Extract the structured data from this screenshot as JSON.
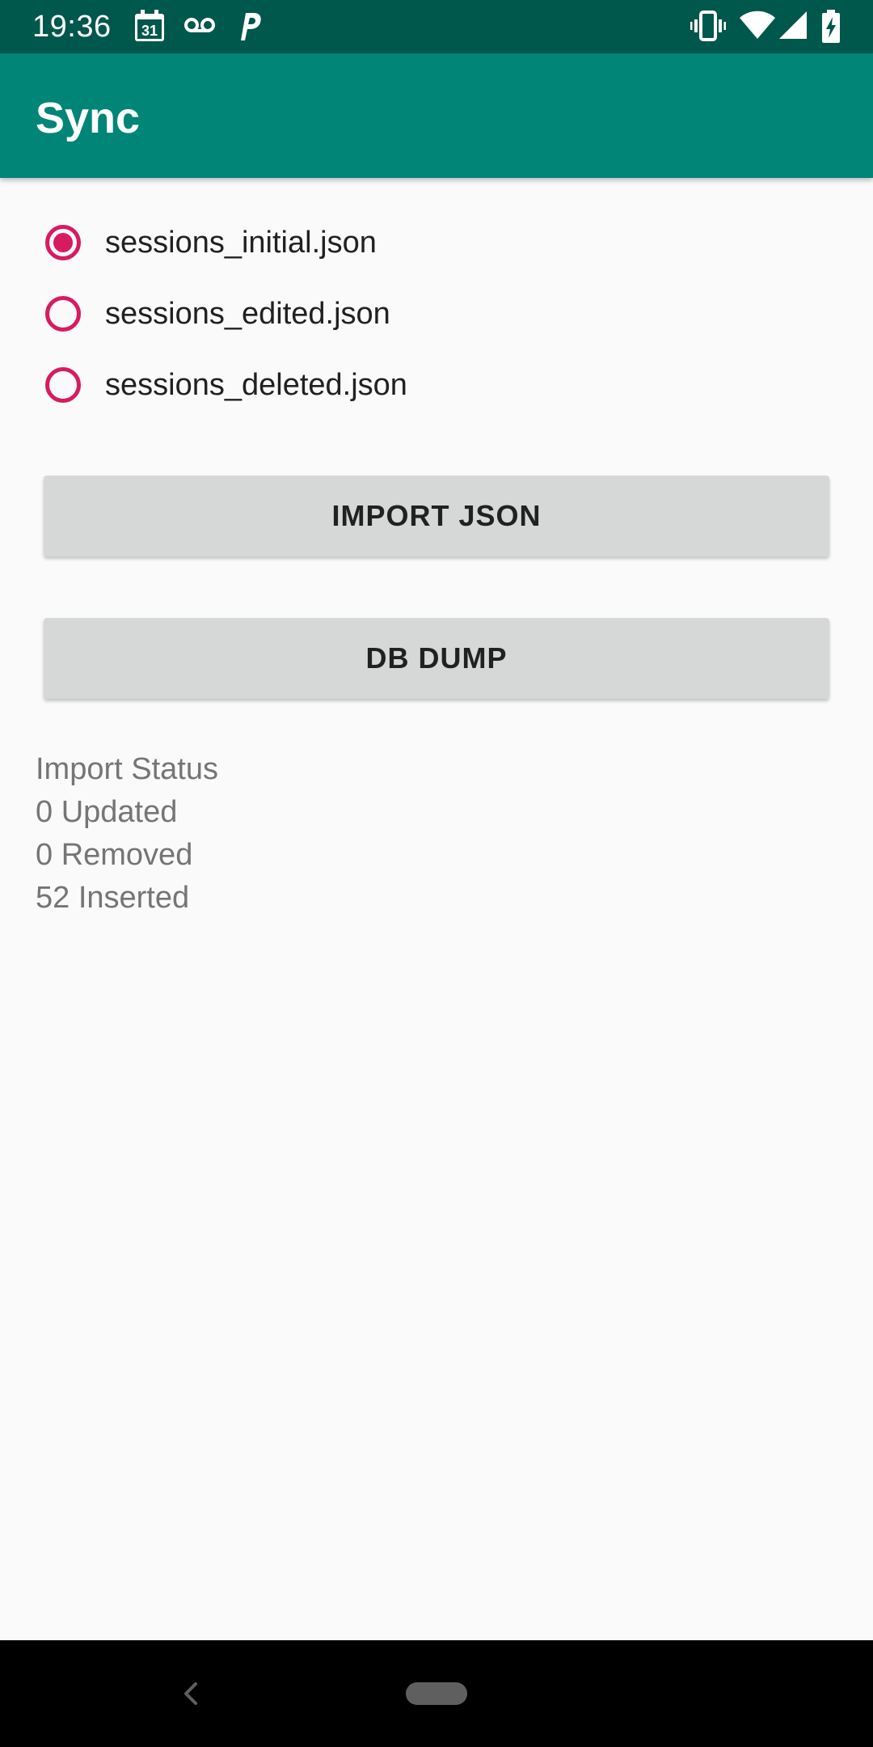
{
  "status_bar": {
    "time": "19:36",
    "calendar_day": "31",
    "icons": [
      "calendar-icon",
      "voicemail-icon",
      "parking-icon",
      "vibrate-icon",
      "wifi-icon",
      "signal-icon",
      "battery-charging-icon"
    ]
  },
  "app_bar": {
    "title": "Sync"
  },
  "radio_group": {
    "options": [
      {
        "label": "sessions_initial.json",
        "checked": true
      },
      {
        "label": "sessions_edited.json",
        "checked": false
      },
      {
        "label": "sessions_deleted.json",
        "checked": false
      }
    ]
  },
  "buttons": {
    "import_label": "IMPORT JSON",
    "dump_label": "DB DUMP"
  },
  "import_status": {
    "heading": "Import Status",
    "updated": "0 Updated",
    "removed": "0 Removed",
    "inserted": "52 Inserted"
  },
  "colors": {
    "status_bar": "#00574b",
    "app_bar": "#008577",
    "accent": "#d81b60",
    "button": "#d6d7d7",
    "background": "#fafafa"
  },
  "nav_bar": {
    "icons": [
      "back-icon",
      "home-pill-icon"
    ]
  }
}
